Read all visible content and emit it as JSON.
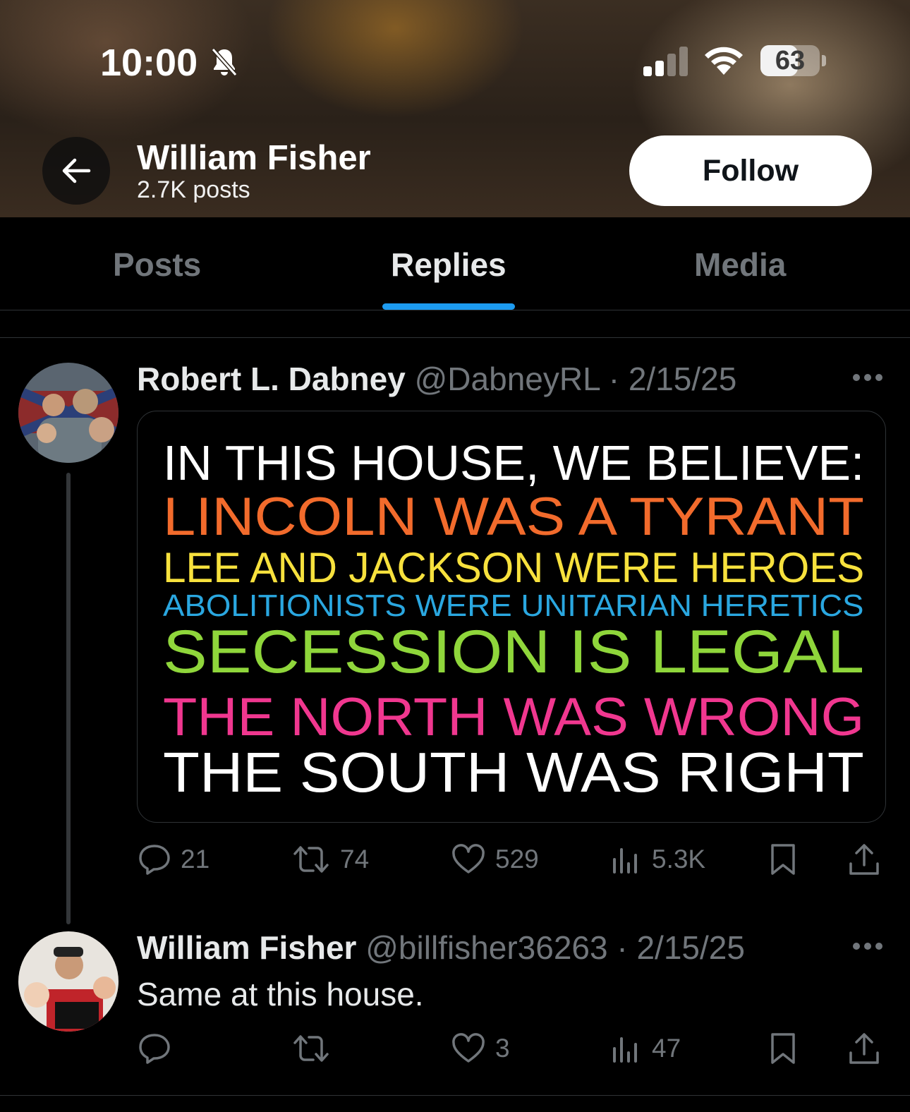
{
  "status_bar": {
    "time": "10:00",
    "battery": "63",
    "battery_level": 0.63
  },
  "profile": {
    "name": "William Fisher",
    "posts_count": "2.7K posts",
    "follow_label": "Follow"
  },
  "tabs": [
    {
      "label": "Posts"
    },
    {
      "label": "Replies"
    },
    {
      "label": "Media"
    }
  ],
  "posts": [
    {
      "name": "Robert L. Dabney",
      "handle": "@DabneyRL",
      "sep": " · ",
      "date": "2/15/25",
      "image_text": [
        {
          "text": "IN THIS HOUSE, WE BELIEVE:",
          "color": "#ffffff"
        },
        {
          "text": "LINCOLN WAS A TYRANT",
          "color": "#f26b2c"
        },
        {
          "text": "LEE AND JACKSON WERE HEROES",
          "color": "#f7e13d"
        },
        {
          "text": "ABOLITIONISTS WERE UNITARIAN HERETICS",
          "color": "#2aa7e0"
        },
        {
          "text": "SECESSION IS LEGAL",
          "color": "#8fd63b"
        },
        {
          "text": "THE NORTH WAS WRONG",
          "color": "#f0378f"
        },
        {
          "text": "THE SOUTH WAS RIGHT",
          "color": "#ffffff"
        }
      ],
      "actions": {
        "replies": "21",
        "reposts": "74",
        "likes": "529",
        "views": "5.3K"
      }
    },
    {
      "name": "William Fisher",
      "handle": "@billfisher36263",
      "sep": " · ",
      "date": "2/15/25",
      "text": "Same at this house.",
      "actions": {
        "replies": "",
        "reposts": "",
        "likes": "3",
        "views": "47"
      }
    }
  ],
  "colors": {
    "accent": "#1d9bf0",
    "muted": "#71767b",
    "text": "#e7e9ea",
    "divider": "#2f3336"
  }
}
